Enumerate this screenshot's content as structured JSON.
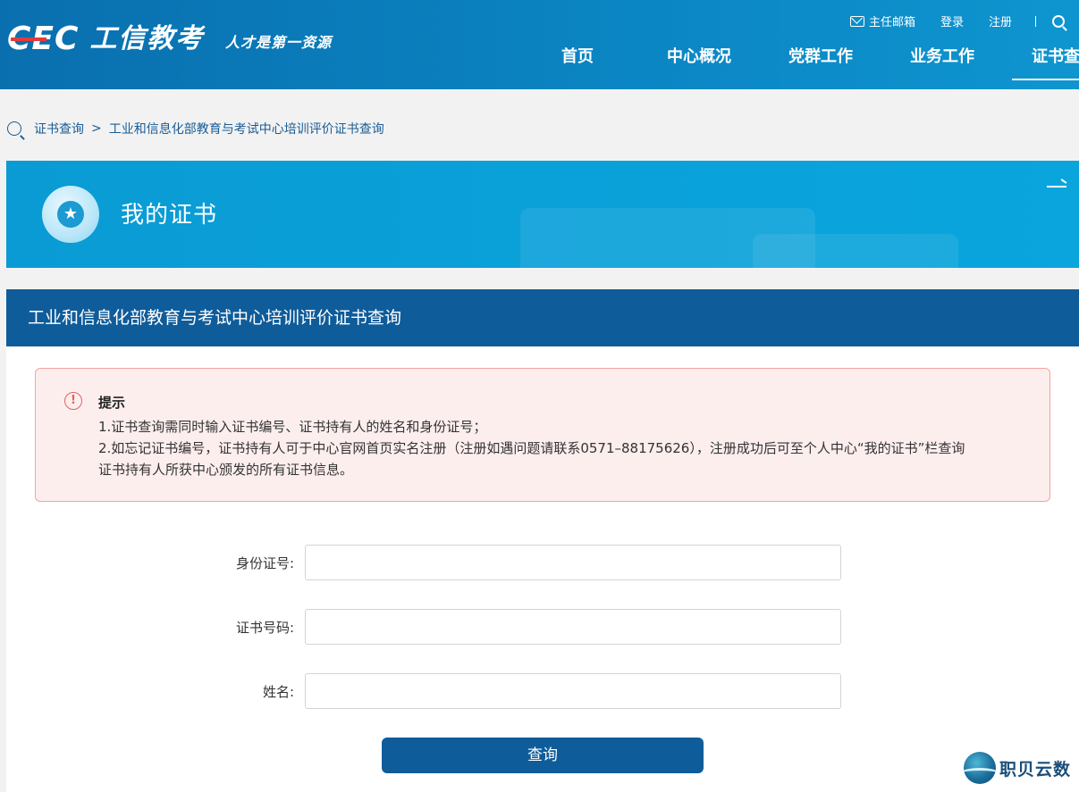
{
  "header": {
    "logo_mark": "CEC",
    "logo_text": "工信教考",
    "slogan": "人才是第一资源",
    "top_links": {
      "mail": "主任邮箱",
      "login": "登录",
      "register": "注册"
    },
    "nav": [
      {
        "label": "首页"
      },
      {
        "label": "中心概况"
      },
      {
        "label": "党群工作"
      },
      {
        "label": "业务工作"
      },
      {
        "label": "证书查询",
        "active": true
      }
    ]
  },
  "breadcrumb": {
    "items": [
      "证书查询",
      "工业和信息化部教育与考试中心培训评价证书查询"
    ],
    "separator": ">"
  },
  "banner": {
    "title": "我的证书"
  },
  "panel": {
    "title": "工业和信息化部教育与考试中心培训评价证书查询",
    "notice": {
      "title": "提示",
      "lines": [
        "1.证书查询需同时输入证书编号、证书持有人的姓名和身份证号；",
        "2.如忘记证书编号，证书持有人可于中心官网首页实名注册（注册如遇问题请联系0571–88175626），注册成功后可至个人中心“我的证书”栏查询",
        "证书持有人所获中心颁发的所有证书信息。"
      ]
    },
    "form": {
      "id_label": "身份证号:",
      "id_value": "",
      "cert_label": "证书号码:",
      "cert_value": "",
      "name_label": "姓名:",
      "name_value": "",
      "submit": "查询"
    }
  },
  "watermark": {
    "text": "职贝云数"
  },
  "colors": {
    "header_blue": "#0b86c4",
    "panel_header": "#0f5c9a",
    "banner_blue": "#0aa5dd",
    "notice_bg": "#fdeeee",
    "notice_border": "#f3a3a3",
    "logo_red": "#e23b3b"
  },
  "icons": [
    "mail-icon",
    "search-icon",
    "medal-icon",
    "exclamation-icon",
    "arrow-right-icon"
  ]
}
